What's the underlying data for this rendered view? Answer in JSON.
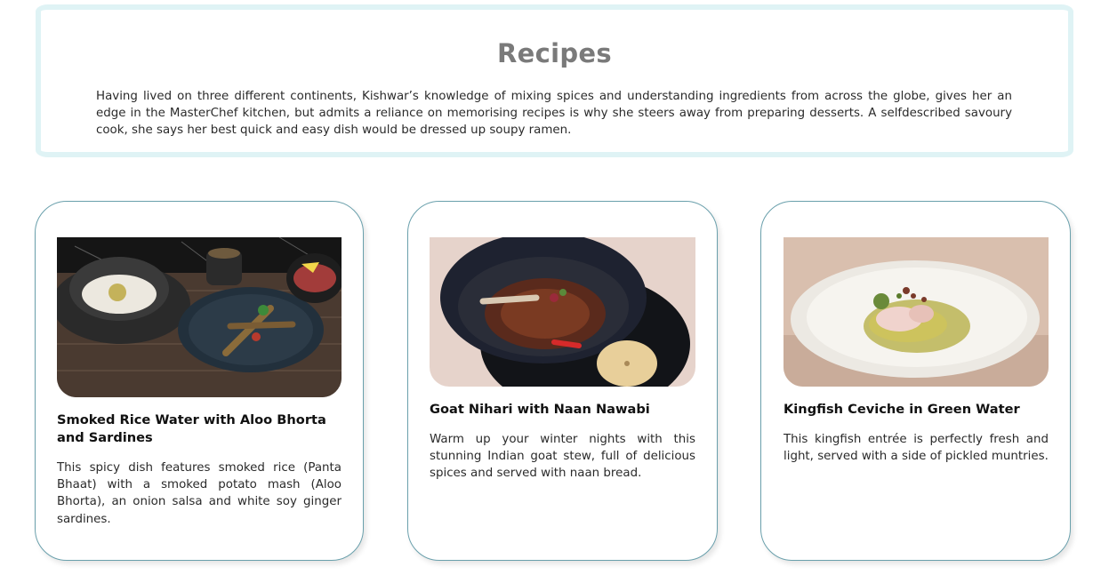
{
  "intro": {
    "title": "Recipes",
    "text": "Having lived on three different continents, Kishwar’s knowledge of mixing spices and understanding ingredients from across the globe, gives her an edge in the MasterChef kitchen, but admits a reliance on memorising recipes is why she steers away from preparing desserts. A selfdescribed savoury cook, she says her best quick and easy dish would be dressed up soupy ramen."
  },
  "recipes": [
    {
      "title": "Smoked Rice Water with Aloo Bhorta and Sardines",
      "description": "This spicy dish features smoked rice (Panta Bhaat) with a smoked potato mash (Aloo Bhorta), an onion salsa and white soy ginger sardines."
    },
    {
      "title": "Goat Nihari with Naan Nawabi",
      "description": "Warm up your winter nights with this stunning Indian goat stew, full of delicious spices and served with naan bread."
    },
    {
      "title": "Kingfish Ceviche in Green Water",
      "description": "This kingfish entrée is perfectly fresh and light, served with a side of pickled muntries."
    }
  ]
}
